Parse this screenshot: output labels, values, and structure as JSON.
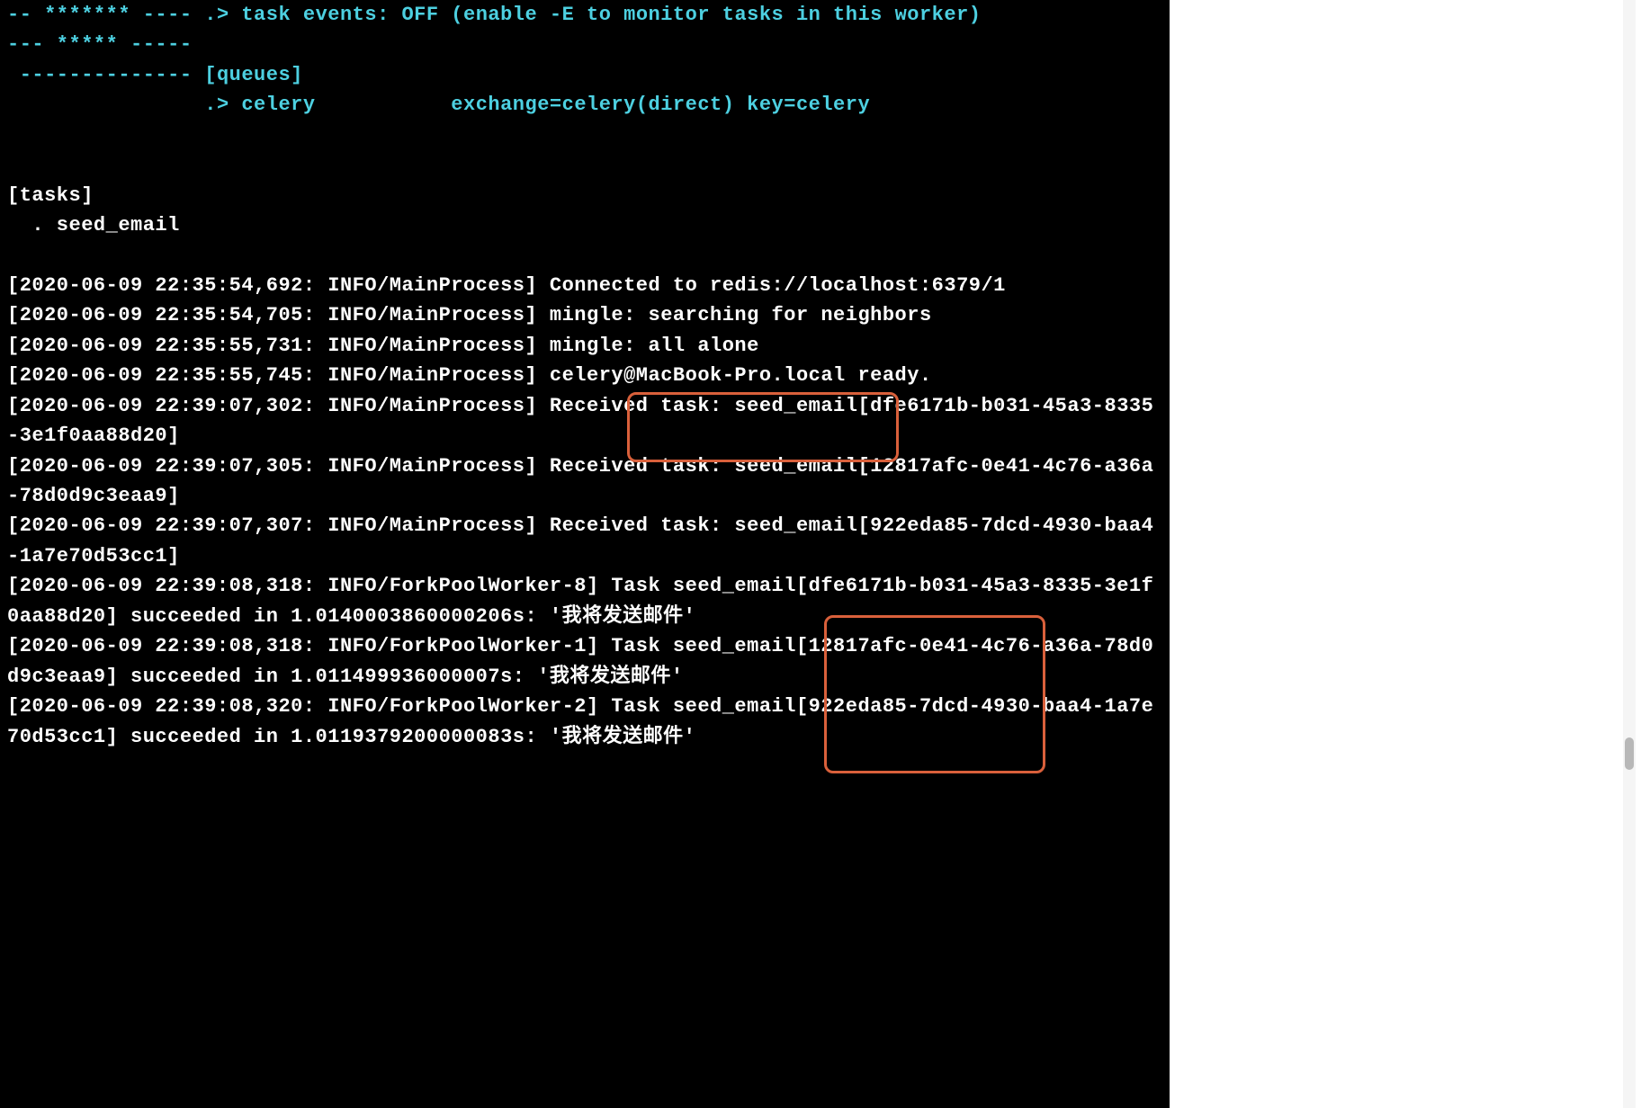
{
  "header": {
    "line1_prefix": "-- ******* ----",
    "line1_content": ".> task events: OFF (enable -E to monitor tasks in this worker)",
    "line2": "--- ***** -----",
    "line3_prefix": " --------------",
    "line3_content": "[queues]",
    "line4_prefix": "               ",
    "line4_content": ".> celery           exchange=celery(direct) key=celery"
  },
  "tasks": {
    "header": "[tasks]",
    "item": "  . seed_email"
  },
  "logs": {
    "l1": "[2020-06-09 22:35:54,692: INFO/MainProcess] Connected to redis://localhost:6379/1",
    "l2": "[2020-06-09 22:35:54,705: INFO/MainProcess] mingle: searching for neighbors",
    "l3": "[2020-06-09 22:35:55,731: INFO/MainProcess] mingle: all alone",
    "l4": "[2020-06-09 22:35:55,745: INFO/MainProcess] celery@MacBook-Pro.local ready.",
    "l5": "[2020-06-09 22:39:07,302: INFO/MainProcess] Received task: seed_email[dfe6171b-b031-45a3-8335-3e1f0aa88d20]",
    "l6": "[2020-06-09 22:39:07,305: INFO/MainProcess] Received task: seed_email[12817afc-0e41-4c76-a36a-78d0d9c3eaa9]",
    "l7": "[2020-06-09 22:39:07,307: INFO/MainProcess] Received task: seed_email[922eda85-7dcd-4930-baa4-1a7e70d53cc1]",
    "l8": "[2020-06-09 22:39:08,318: INFO/ForkPoolWorker-8] Task seed_email[dfe6171b-b031-45a3-8335-3e1f0aa88d20] succeeded in 1.0140003860000206s: '我将发送邮件'",
    "l9": "[2020-06-09 22:39:08,318: INFO/ForkPoolWorker-1] Task seed_email[12817afc-0e41-4c76-a36a-78d0d9c3eaa9] succeeded in 1.011499936000007s: '我将发送邮件'",
    "l10": "[2020-06-09 22:39:08,320: INFO/ForkPoolWorker-2] Task seed_email[922eda85-7dcd-4930-baa4-1a7e70d53cc1] succeeded in 1.0119379200000083s: '我将发送邮件'"
  }
}
